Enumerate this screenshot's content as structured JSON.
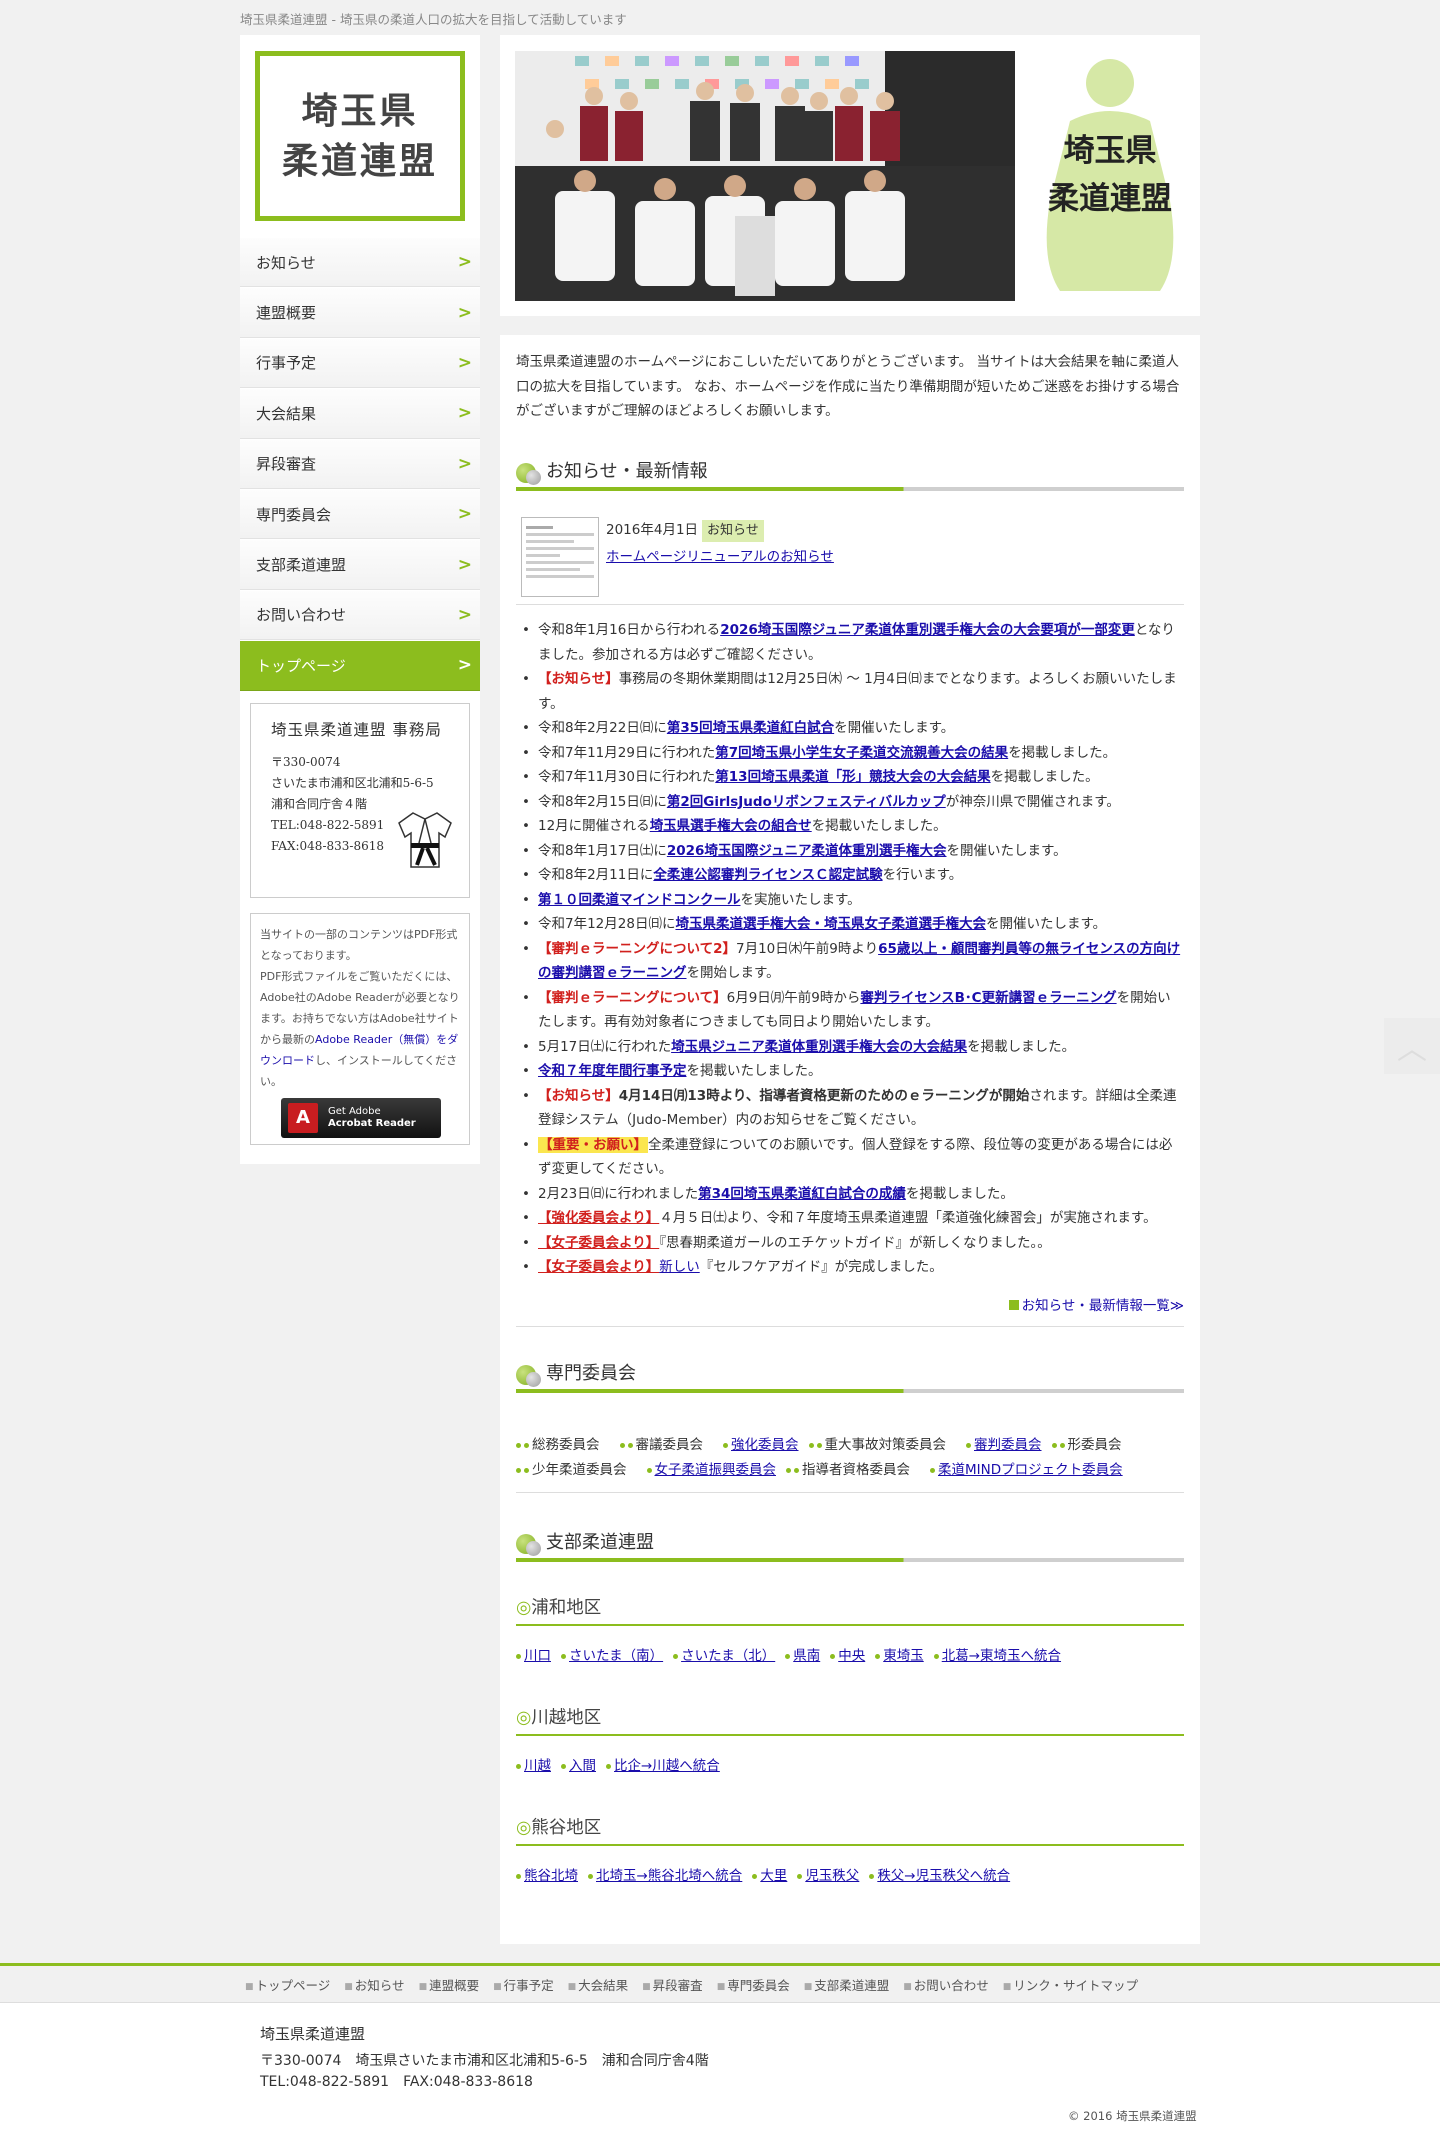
{
  "site": {
    "tagline": "埼玉県柔道連盟 - 埼玉県の柔道人口の拡大を目指して活動しています",
    "logo_line1": "埼玉県",
    "logo_line2": "柔道連盟"
  },
  "nav": [
    {
      "label": "お知らせ",
      "arrow": ">"
    },
    {
      "label": "連盟概要",
      "arrow": ">"
    },
    {
      "label": "行事予定",
      "arrow": ">"
    },
    {
      "label": "大会結果",
      "arrow": ">"
    },
    {
      "label": "昇段審査",
      "arrow": ">"
    },
    {
      "label": "専門委員会",
      "arrow": ">"
    },
    {
      "label": "支部柔道連盟",
      "arrow": ">"
    },
    {
      "label": "お問い合わせ",
      "arrow": ">"
    },
    {
      "label": "トップページ",
      "arrow": ">"
    }
  ],
  "office": {
    "title": "埼玉県柔道連盟 事務局",
    "zip": "〒330-0074",
    "addr1": "さいたま市浦和区北浦和5-6-5",
    "addr2": "浦和合同庁舎４階",
    "tel": "TEL:048-822-5891",
    "fax": "FAX:048-833-8618"
  },
  "pdf": {
    "t1": "当サイトの一部のコンテンツはPDF形式となっております。",
    "t2": "PDF形式ファイルをご覧いただくには、Adobe社のAdobe Readerが必要となります。お持ちでない方はAdobe社サイトから最新の",
    "link": "Adobe Reader（無償）をダウンロード",
    "t3": "し、インストールしてください。",
    "btn1": "Get Adobe",
    "btn2": "Acrobat Reader"
  },
  "header": {
    "logo_line1": "埼玉県",
    "logo_line2": "柔道連盟"
  },
  "intro": "埼玉県柔道連盟のホームページにおこしいただいてありがとうございます。 当サイトは大会結果を軸に柔道人口の拡大を目指しています。 なお、ホームページを作成に当たり準備期間が短いためご迷惑をお掛けする場合がございますがご理解のほどよろしくお願いします。",
  "news": {
    "heading": "お知らせ・最新情報",
    "top_date": "2016年4月1日",
    "top_badge": "お知らせ",
    "top_title": "ホームページリニューアルのお知らせ",
    "items": [
      {
        "a": "令和8年1月16日から行われる",
        "l": "2026埼玉国際ジュニア柔道体重別選手権大会の大会要項が一部変更",
        "b": "となりました。参加される方は必ずご確認ください。"
      },
      {
        "r": "【お知らせ】",
        "b": "事務局の冬期休業期間は12月25日㈭ ～ 1月4日㈰までとなります。よろしくお願いいたします。"
      },
      {
        "a": "令和8年2月22日㈰に",
        "l": "第35回埼玉県柔道紅白試合",
        "b": "を開催いたします。"
      },
      {
        "a": "令和7年11月29日に行われた",
        "l": "第7回埼玉県小学生女子柔道交流親善大会の結果",
        "b": "を掲載しました。"
      },
      {
        "a": "令和7年11月30日に行われた",
        "l": "第13回埼玉県柔道「形」競技大会の大会結果",
        "b": "を掲載しました。"
      },
      {
        "a": "令和8年2月15日㈰に",
        "l": "第2回GirlsJudoリボンフェスティバルカップ",
        "b": "が神奈川県で開催されます。"
      },
      {
        "a": "12月に開催される",
        "l": "埼玉県選手権大会の組合せ",
        "b": "を掲載いたしました。"
      },
      {
        "a": "令和8年1月17日㈯に",
        "l": "2026埼玉国際ジュニア柔道体重別選手権大会",
        "b": "を開催いたします。"
      },
      {
        "a": "令和8年2月11日に",
        "l": "全柔連公認審判ライセンスＣ認定試験",
        "b": "を行います。"
      },
      {
        "a": "",
        "l": "第１０回柔道マインドコンクール",
        "b": "を実施いたします。"
      },
      {
        "a": "令和7年12月28日㈰に",
        "l": "埼玉県柔道選手権大会・埼玉県女子柔道選手権大会",
        "b": "を開催いたします。"
      },
      {
        "r": "【審判ｅラーニングについて2】",
        "a": "7月10日㈭午前9時より",
        "l": "65歳以上・顧問審判員等の無ライセンスの方向けの審判講習ｅラーニング",
        "b": "を開始します。"
      },
      {
        "r": "【審判ｅラーニングについて】",
        "a": "6月9日㈪午前9時から",
        "l": "審判ライセンスB･C更新講習ｅラーニング",
        "b": "を開始いたします。再有効対象者につきましても同日より開始いたします。"
      },
      {
        "a": "5月17日㈯に行われた",
        "l": "埼玉県ジュニア柔道体重別選手権大会の大会結果",
        "b": "を掲載しました。"
      },
      {
        "a": "",
        "l": "令和７年度年間行事予定",
        "b": "を掲載いたしました。"
      },
      {
        "r": "【お知らせ】",
        "k": "4月14日㈪13時より、指導者資格更新のためのｅラーニングが開始",
        "b": "されます。詳細は全柔連登録システム（Judo-Member）内のお知らせをご覧ください。"
      },
      {
        "h": "【重要・お願い】",
        "b": "全柔連登録についてのお願いです。個人登録をする際、段位等の変更がある場合には必ず変更してください。"
      },
      {
        "a": "2月23日㈰に行われました",
        "l": "第34回埼玉県柔道紅白試合の成績",
        "b": "を掲載しました。"
      },
      {
        "rl": "【強化委員会より】",
        "b": "４月５日㈯より、令和７年度埼玉県柔道連盟「柔道強化練習会」が実施されます。"
      },
      {
        "rl": "【女子委員会より】",
        "b": "『思春期柔道ガールのエチケットガイド』が新しくなりました。。"
      },
      {
        "rl": "【女子委員会より】",
        "l2": "新しい",
        "b": "『セルフケアガイド』が完成しました。"
      }
    ],
    "more": "お知らせ・最新情報一覧≫"
  },
  "committee": {
    "heading": "専門委員会",
    "items": [
      {
        "label": "総務委員会",
        "link": false
      },
      {
        "label": "審議委員会",
        "link": false
      },
      {
        "label": "強化委員会",
        "link": true
      },
      {
        "label": "重大事故対策委員会",
        "link": false
      },
      {
        "label": "審判委員会",
        "link": true
      },
      {
        "label": "形委員会",
        "link": false
      },
      {
        "label": "少年柔道委員会",
        "link": false
      },
      {
        "label": "女子柔道振興委員会",
        "link": true
      },
      {
        "label": "指導者資格委員会",
        "link": false
      },
      {
        "label": "柔道MINDプロジェクト委員会",
        "link": true
      }
    ]
  },
  "branch": {
    "heading": "支部柔道連盟",
    "regions": [
      {
        "name": "浦和地区",
        "mark": "◎",
        "items": [
          "川口",
          "さいたま（南）",
          "さいたま（北）",
          "県南",
          "中央",
          "東埼玉",
          "北葛→東埼玉へ統合"
        ]
      },
      {
        "name": "川越地区",
        "mark": "◎",
        "items": [
          "川越",
          "入間",
          "比企→川越へ統合"
        ]
      },
      {
        "name": "熊谷地区",
        "mark": "◎",
        "items": [
          "熊谷北埼",
          "北埼玉→熊谷北埼へ統合",
          "大里",
          "児玉秩父",
          "秩父→児玉秩父へ統合"
        ]
      }
    ]
  },
  "footer_nav": [
    "トップページ",
    "お知らせ",
    "連盟概要",
    "行事予定",
    "大会結果",
    "昇段審査",
    "専門委員会",
    "支部柔道連盟",
    "お問い合わせ",
    "リンク・サイトマップ"
  ],
  "footer": {
    "org": "埼玉県柔道連盟",
    "addr": "〒330-0074　埼玉県さいたま市浦和区北浦和5-6-5　浦和合同庁舎4階",
    "tel": "TEL:048-822-5891　FAX:048-833-8618",
    "copy": "© 2016 埼玉県柔道連盟"
  },
  "colors": {
    "accent": "#8cbd1e",
    "link": "#1a0dab",
    "alert": "#d1201d"
  },
  "icons": {
    "totop": "chevron-up-icon",
    "pdf": "adobe-acrobat-icon",
    "gi": "judo-gi-icon"
  }
}
